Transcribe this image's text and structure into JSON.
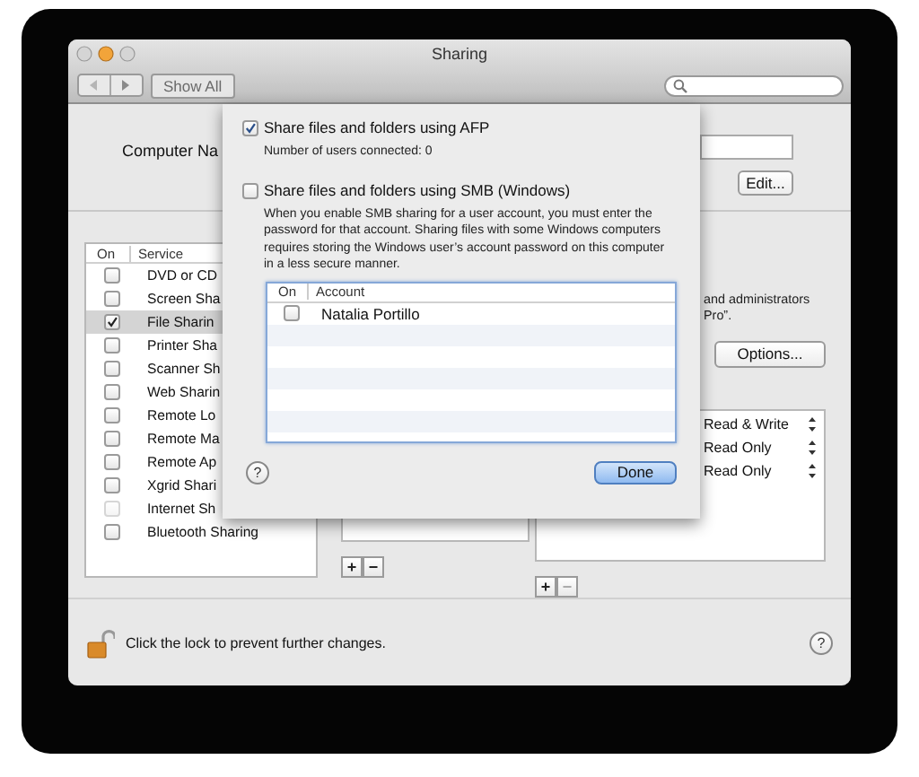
{
  "window": {
    "title": "Sharing"
  },
  "toolbar": {
    "show_all": "Show All"
  },
  "computer_name": {
    "label": "Computer Na",
    "edit_button": "Edit..."
  },
  "services": {
    "columns": [
      "On",
      "Service"
    ],
    "items": [
      {
        "name": "DVD or CD",
        "checked": false,
        "selected": false,
        "disabled": false
      },
      {
        "name": "Screen Sha",
        "checked": false,
        "selected": false,
        "disabled": false
      },
      {
        "name": "File Sharin",
        "checked": true,
        "selected": true,
        "disabled": false
      },
      {
        "name": "Printer Sha",
        "checked": false,
        "selected": false,
        "disabled": false
      },
      {
        "name": "Scanner Sh",
        "checked": false,
        "selected": false,
        "disabled": false
      },
      {
        "name": "Web Sharin",
        "checked": false,
        "selected": false,
        "disabled": false
      },
      {
        "name": "Remote Lo",
        "checked": false,
        "selected": false,
        "disabled": false
      },
      {
        "name": "Remote Ma",
        "checked": false,
        "selected": false,
        "disabled": false
      },
      {
        "name": "Remote Ap",
        "checked": false,
        "selected": false,
        "disabled": false
      },
      {
        "name": "Xgrid Shari",
        "checked": false,
        "selected": false,
        "disabled": false
      },
      {
        "name": "Internet Sh",
        "checked": false,
        "selected": false,
        "disabled": true
      },
      {
        "name": "Bluetooth Sharing",
        "checked": false,
        "selected": false,
        "disabled": false
      }
    ]
  },
  "options_text": [
    "and administrators",
    "Pro”."
  ],
  "options_button": "Options...",
  "permissions": [
    "Read & Write",
    "Read Only",
    "Read Only"
  ],
  "list_controls": [
    {
      "add": "+",
      "remove": "−",
      "remove_disabled": false
    },
    {
      "add": "+",
      "remove": "−",
      "remove_disabled": true
    }
  ],
  "lock": {
    "text": "Click the lock to prevent further changes.",
    "locked": false
  },
  "help": "?",
  "sheet": {
    "afp": {
      "label": "Share files and folders using AFP",
      "checked": true
    },
    "users_connected": "Number of users connected: 0",
    "smb": {
      "label": "Share files and folders using SMB (Windows)",
      "checked": false
    },
    "smb_note": "When you enable SMB sharing for a user account, you must enter the password for that account. Sharing files with some Windows computers requires storing the Windows user’s account password on this computer in a less secure manner.",
    "accounts": {
      "columns": [
        "On",
        "Account"
      ],
      "rows": [
        {
          "name": "Natalia Portillo",
          "checked": false
        }
      ]
    },
    "help": "?",
    "done": "Done"
  }
}
